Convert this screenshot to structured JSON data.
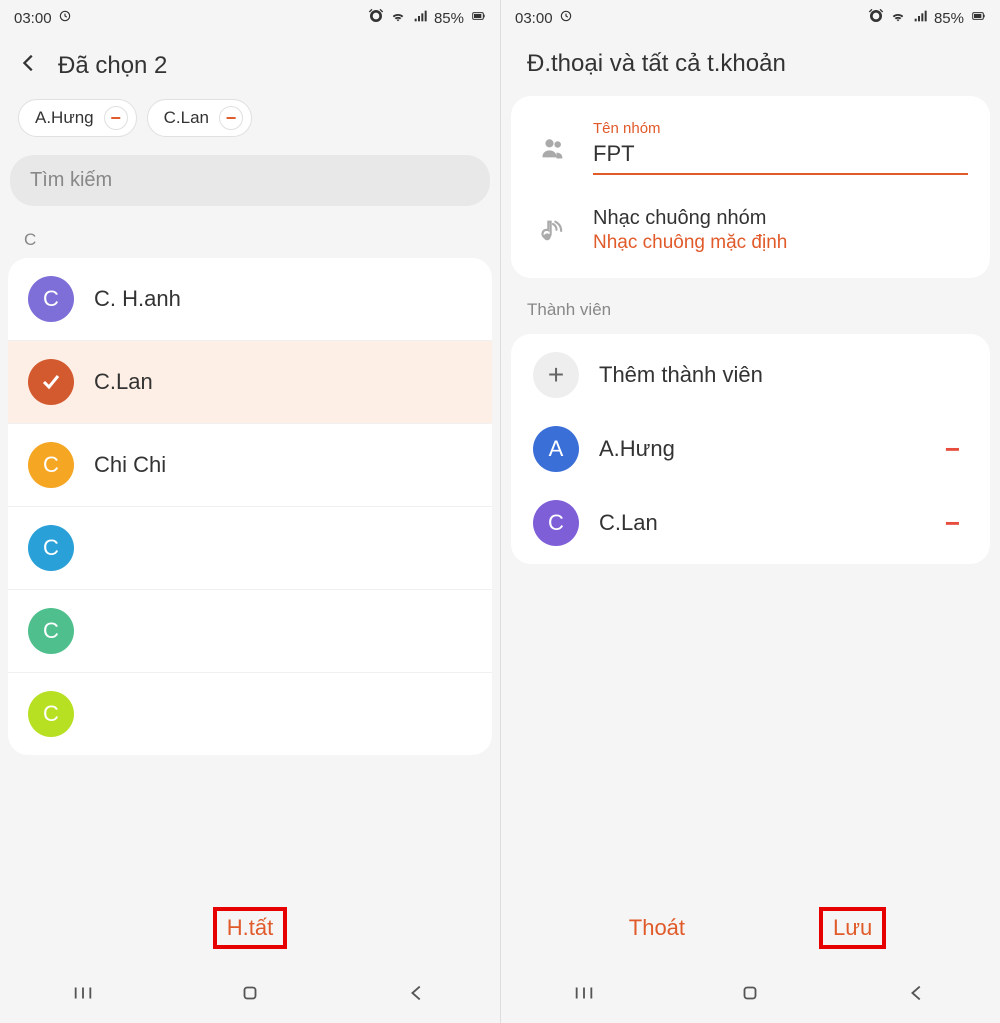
{
  "status": {
    "time": "03:00",
    "battery": "85%"
  },
  "left": {
    "title": "Đã chọn 2",
    "chips": [
      "A.Hưng",
      "C.Lan"
    ],
    "search_placeholder": "Tìm kiếm",
    "section": "C",
    "contacts": [
      {
        "letter": "C",
        "name": "C. H.anh",
        "color": "#7e6fd8",
        "selected": false
      },
      {
        "letter": "",
        "name": "C.Lan",
        "color": "#d35a2f",
        "selected": true
      },
      {
        "letter": "C",
        "name": "Chi Chi",
        "color": "#f5a623",
        "selected": false
      },
      {
        "letter": "C",
        "name": "",
        "color": "#29a0d8",
        "selected": false
      },
      {
        "letter": "C",
        "name": "",
        "color": "#4fc08d",
        "selected": false
      },
      {
        "letter": "C",
        "name": "",
        "color": "#b8e023",
        "selected": false
      }
    ],
    "done_label": "H.tất"
  },
  "right": {
    "title": "Đ.thoại và tất cả t.khoản",
    "group_name_label": "Tên nhóm",
    "group_name_value": "FPT",
    "ringtone_label": "Nhạc chuông nhóm",
    "ringtone_value": "Nhạc chuông mặc định",
    "members_label": "Thành viên",
    "add_member_label": "Thêm thành viên",
    "members": [
      {
        "letter": "A",
        "name": "A.Hưng",
        "color": "#3b6fd8"
      },
      {
        "letter": "C",
        "name": "C.Lan",
        "color": "#7e5fd8"
      }
    ],
    "cancel_label": "Thoát",
    "save_label": "Lưu"
  }
}
